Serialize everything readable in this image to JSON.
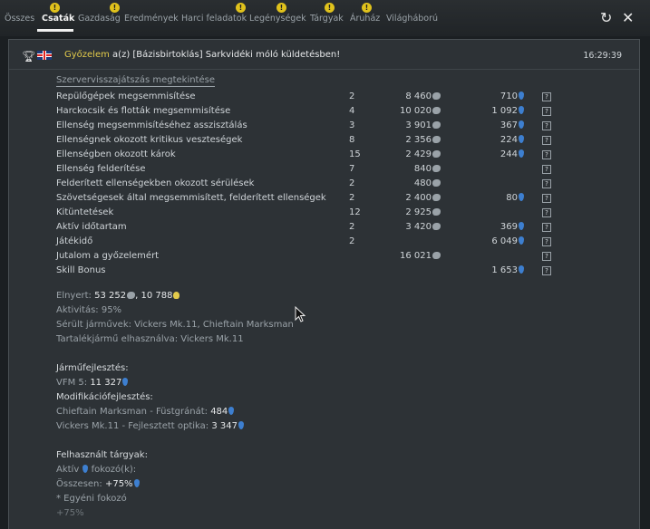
{
  "tabs": [
    {
      "label": "Összes",
      "badge": ""
    },
    {
      "label": "Csaták",
      "badge": "!"
    },
    {
      "label": "Gazdaság",
      "badge": ""
    },
    {
      "label": "Eredmények",
      "badge": "!"
    },
    {
      "label": "Harci feladatok",
      "badge": "!"
    },
    {
      "label": "Legénységek",
      "badge": "!"
    },
    {
      "label": "Tárgyak",
      "badge": "!"
    },
    {
      "label": "Áruház",
      "badge": "!"
    },
    {
      "label": "Világháború",
      "badge": ""
    }
  ],
  "active_tab": "Csaták",
  "message": {
    "result": "Győzelem",
    "text": " a(z) [Bázisbirtoklás] Sarkvidéki móló küldetésben!",
    "time": "16:29:39"
  },
  "replay_link": "Szervervisszajátszás megtekintése",
  "stats": [
    {
      "label": "Repülőgépek megsemmisítése",
      "count": "2",
      "xp": "8 460",
      "fx": "710"
    },
    {
      "label": "Harckocsik és flották megsemmisítése",
      "count": "4",
      "xp": "10 020",
      "fx": "1 092"
    },
    {
      "label": "Ellenség megsemmisítéséhez asszisztálás",
      "count": "3",
      "xp": "3 901",
      "fx": "367"
    },
    {
      "label": "Ellenségnek okozott kritikus veszteségek",
      "count": "8",
      "xp": "2 356",
      "fx": "224"
    },
    {
      "label": "Ellenségben okozott károk",
      "count": "15",
      "xp": "2 429",
      "fx": "244"
    },
    {
      "label": "Ellenség felderítése",
      "count": "7",
      "xp": "840",
      "fx": ""
    },
    {
      "label": "Felderített ellenségekben okozott sérülések",
      "count": "2",
      "xp": "480",
      "fx": ""
    },
    {
      "label": "Szövetségesek által megsemmisített, felderített ellenségek",
      "count": "2",
      "xp": "2 400",
      "fx": "80"
    },
    {
      "label": "Kitüntetések",
      "count": "12",
      "xp": "2 925",
      "fx": ""
    },
    {
      "label": "Aktív időtartam",
      "count": "2",
      "xp": "3 420",
      "fx": "369"
    },
    {
      "label": "Játékidő",
      "count": "2",
      "xp": "",
      "fx": "6 049"
    },
    {
      "label": "Jutalom a győzelemért",
      "count": "",
      "xp": "16 021",
      "fx": ""
    },
    {
      "label": "Skill Bonus",
      "count": "",
      "xp": "",
      "fx": "1 653"
    }
  ],
  "summary": {
    "earned_label": "Elnyert: ",
    "earned_xp": "53 252",
    "earned_sep": ", ",
    "earned_gold": "10 788",
    "activity": "Aktivitás: 95%",
    "damaged": "Sérült járművek: Vickers Mk.11, Chieftain Marksman",
    "reserve": "Tartalékjármű elhasználva: Vickers Mk.11"
  },
  "research": {
    "vehicle_head": "Járműfejlesztés:",
    "vehicle_name": "VFM 5: ",
    "vehicle_value": "11 327",
    "mod_head": "Modifikációfejlesztés:",
    "mod1_name": "Chieftain Marksman - Füstgránát: ",
    "mod1_value": "484",
    "mod2_name": "Vickers Mk.11 - Fejlesztett optika: ",
    "mod2_value": "3 347"
  },
  "items": {
    "head": "Felhasznált tárgyak:",
    "active_a": "Aktív ",
    "active_b": " fokozó(k):",
    "total_label": "Összesen: ",
    "total_value": "+75%",
    "personal": "* Egyéni fokozó",
    "partial": "+75%"
  },
  "colors": {
    "win": "#e3cb4b",
    "research_point": "#3d7fd0",
    "badge": "#e0c21c"
  }
}
